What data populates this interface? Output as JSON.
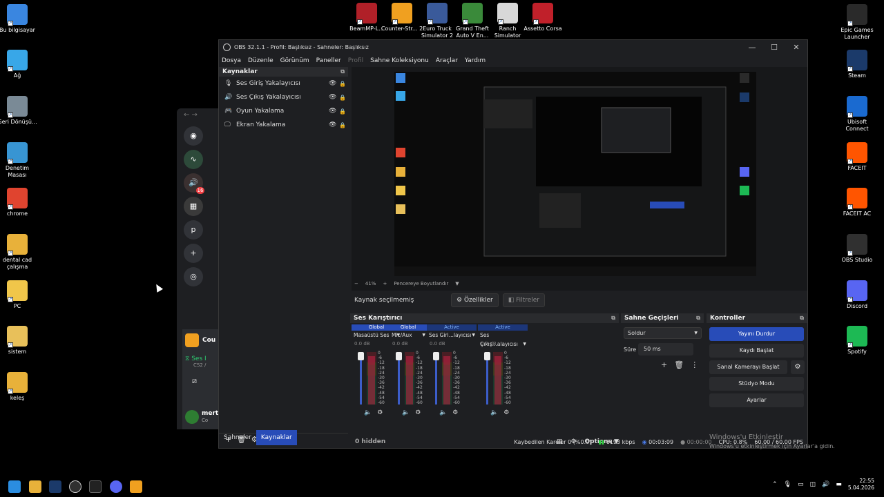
{
  "desktop": {
    "left_icons": [
      {
        "label": "Bu bilgisayar",
        "icon": "computer-icon",
        "color": "#3a86e0"
      },
      {
        "label": "Ağ",
        "icon": "network-icon",
        "color": "#38a7e8"
      },
      {
        "label": "Geri Dönüşü...",
        "icon": "recycle-bin-icon",
        "color": "#7a8a96"
      },
      {
        "label": "Denetim Masası",
        "icon": "control-panel-icon",
        "color": "#3895d3"
      },
      {
        "label": "chrome",
        "icon": "chrome-icon",
        "color": "#e0442f"
      },
      {
        "label": "dental cad çalışma",
        "icon": "folder-icon",
        "color": "#e8b13a"
      },
      {
        "label": "PC",
        "icon": "folder-icon",
        "color": "#f0c64a"
      },
      {
        "label": "sistem",
        "icon": "folder-icon",
        "color": "#e8c05a"
      },
      {
        "label": "keleş",
        "icon": "folder-icon",
        "color": "#e8b13a"
      }
    ],
    "top_icons": [
      {
        "label": "BeamMP-L...",
        "icon": "beammp-icon",
        "color": "#b02028"
      },
      {
        "label": "Counter-Str... 2",
        "icon": "cs2-icon",
        "color": "#f0a020"
      },
      {
        "label": "Euro Truck Simulator 2",
        "icon": "ets2-icon",
        "color": "#3a5a9a"
      },
      {
        "label": "Grand Theft Auto V En...",
        "icon": "gta-icon",
        "color": "#3a8a3a"
      },
      {
        "label": "Ranch Simulator",
        "icon": "ranch-icon",
        "color": "#d8d8d8"
      },
      {
        "label": "Assetto Corsa",
        "icon": "assetto-icon",
        "color": "#c0202a"
      }
    ],
    "right_icons": [
      {
        "label": "Epic Games Launcher",
        "icon": "epic-icon",
        "color": "#2a2a2a"
      },
      {
        "label": "Steam",
        "icon": "steam-icon",
        "color": "#1b3a6a"
      },
      {
        "label": "Ubisoft Connect",
        "icon": "ubisoft-icon",
        "color": "#1a6ad0"
      },
      {
        "label": "FACEIT",
        "icon": "faceit-icon",
        "color": "#ff5500"
      },
      {
        "label": "FACEIT AC",
        "icon": "faceit-ac-icon",
        "color": "#ff5500"
      },
      {
        "label": "OBS Studio",
        "icon": "obs-icon",
        "color": "#303030"
      },
      {
        "label": "Discord",
        "icon": "discord-icon",
        "color": "#5865f2"
      },
      {
        "label": "Spotify",
        "icon": "spotify-icon",
        "color": "#1db954"
      }
    ]
  },
  "discord": {
    "server_letter": "p",
    "badge": "16",
    "dm_name": "Cou",
    "voice_label": "Ses I",
    "voice_sub": "CS2 /",
    "user_name": "mert",
    "user_status": "Co"
  },
  "obs": {
    "title": "OBS 32.1.1 - Profil: Başlıksız - Sahneler: Başlıksız",
    "menu": [
      "Dosya",
      "Düzenle",
      "Görünüm",
      "Paneller",
      "Profil",
      "Sahne Koleksiyonu",
      "Araçlar",
      "Yardım"
    ],
    "sources_title": "Kaynaklar",
    "sources": [
      {
        "label": "Ses Giriş Yakalayıcısı",
        "icon": "microphone-icon"
      },
      {
        "label": "Ses Çıkış Yakalayıcısı",
        "icon": "speaker-icon"
      },
      {
        "label": "Oyun Yakalama",
        "icon": "gamepad-icon"
      },
      {
        "label": "Ekran Yakalama",
        "icon": "monitor-icon"
      }
    ],
    "tabs": {
      "scenes": "Sahneler",
      "sources": "Kaynaklar"
    },
    "zoom": "41%",
    "fit_label": "Pencereye Boyutlandır",
    "no_source": "Kaynak seçilmemiş",
    "properties": "Özellikler",
    "filters": "Filtreler",
    "mixer_title": "Ses Karıştırıcı",
    "channels": [
      {
        "tag": "Global",
        "name": "Masaüstü Ses",
        "db": "0.0 dB",
        "active": false
      },
      {
        "tag": "Global",
        "name": "Mic/Aux",
        "db": "0.0 dB",
        "active": false
      },
      {
        "tag": "Active",
        "name": "Ses Giri...layıcısı",
        "db": "0.0 dB",
        "active": true
      },
      {
        "tag": "Active",
        "name": "Ses Çıkış...alayıcısı",
        "db": "0.0 dB",
        "active": true
      }
    ],
    "meter_ticks": [
      "0",
      "-6",
      "-12",
      "-18",
      "-24",
      "-30",
      "-36",
      "-42",
      "-48",
      "-54",
      "-60"
    ],
    "hidden": "0 hidden",
    "options": "Options",
    "transitions_title": "Sahne Geçişleri",
    "transition": "Soldur",
    "duration_label": "Süre",
    "duration": "50 ms",
    "controls_title": "Kontroller",
    "controls": {
      "stream": "Yayını Durdur",
      "record": "Kaydı Başlat",
      "vcam": "Sanal Kamerayı Başlat",
      "studio": "Stüdyo Modu",
      "settings": "Ayarlar"
    },
    "status": {
      "dropped": "Kaybedilen Kareler 0 (%0.0)",
      "bitrate": "6193 kbps",
      "stream_time": "00:03:09",
      "rec_time": "00:00:00",
      "cpu": "CPU: 0.8%",
      "fps": "60.00 / 60.00 FPS"
    }
  },
  "watermark": {
    "title": "Windows'u Etkinleştir",
    "sub": "Windows'u etkinleştirmek için Ayarlar'a gidin."
  },
  "taskbar": {
    "time": "22:55",
    "date": "5.04.2026"
  }
}
